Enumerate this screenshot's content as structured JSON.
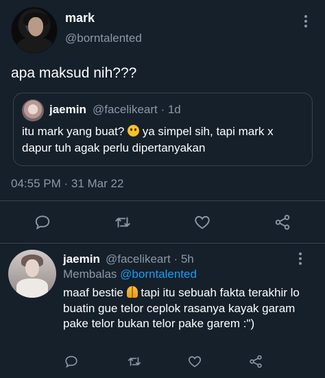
{
  "main_tweet": {
    "display_name": "mark",
    "handle": "@borntalented",
    "text": "apa maksud nih???",
    "timestamp": "04:55 PM · 31 Mar 22",
    "quoted": {
      "display_name": "jaemin",
      "handle": "@facelikeart · 1d",
      "text_before_emoji": "itu mark yang buat? ",
      "emoji": "slightly-frowning-face",
      "text_after_emoji": " ya simpel sih, tapi mark x dapur tuh agak perlu dipertanyakan"
    }
  },
  "reply_tweet": {
    "display_name": "jaemin",
    "handle": "@facelikeart · 5h",
    "replying_prefix": "Membalas",
    "replying_mention": "@borntalented",
    "text_before_emoji": "maaf bestie ",
    "emoji": "folded-hands",
    "text_after_emoji": " tapi itu sebuah fakta terakhir lo buatin gue telor ceplok rasanya kayak garam pake telor bukan telor pake garem :\")"
  },
  "icons": {
    "reply": "comment-icon",
    "retweet": "retweet-icon",
    "like": "heart-icon",
    "share": "share-icon",
    "more": "more-options-icon"
  },
  "colors": {
    "background": "#15202b",
    "text": "#ffffff",
    "secondary_text": "#8b98a5",
    "divider": "#38444d",
    "link": "#1d9bf0"
  }
}
